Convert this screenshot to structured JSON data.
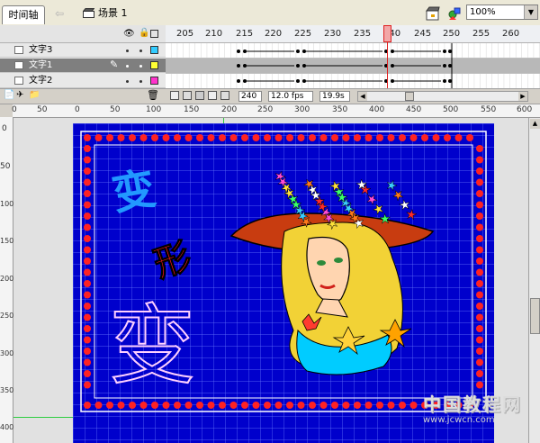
{
  "toolbar": {
    "timeline_tab": "时间轴",
    "scene_label": "场景 1",
    "zoom": "100%"
  },
  "layers": [
    {
      "name": "文字3",
      "color": "#33ccff",
      "selected": false
    },
    {
      "name": "文字1",
      "color": "#ffff33",
      "selected": true
    },
    {
      "name": "文字2",
      "color": "#ff33cc",
      "selected": false
    }
  ],
  "timeline": {
    "frame_numbers": [
      "205",
      "210",
      "215",
      "220",
      "225",
      "230",
      "235",
      "240",
      "245",
      "250",
      "255",
      "260"
    ],
    "current_frame": "240",
    "frame_rate": "12.0 fps",
    "elapsed_time": "19.9s"
  },
  "rulers": {
    "horizontal": [
      "0",
      "50",
      "0",
      "50",
      "100",
      "150",
      "200",
      "250",
      "300",
      "350",
      "400",
      "450",
      "500",
      "550",
      "600"
    ],
    "vertical": [
      "0",
      "50",
      "100",
      "150",
      "200",
      "250",
      "300",
      "350",
      "400"
    ]
  },
  "stage": {
    "text_chars": [
      "变",
      "形",
      "变"
    ],
    "colors": {
      "background": "#0000cc",
      "border_dots": "#ff2222"
    }
  },
  "watermark": {
    "chinese": "中国教程网",
    "url": "www.jcwcn.com"
  }
}
